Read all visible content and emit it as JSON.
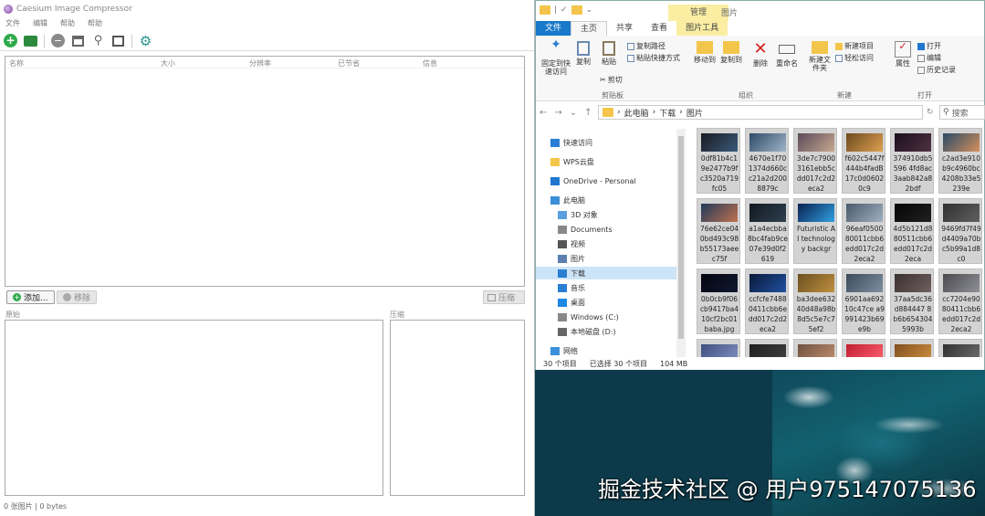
{
  "caesium": {
    "title": "Caesium Image Compressor",
    "menu": [
      "文件",
      "编辑",
      "帮助",
      "帮助"
    ],
    "columns": [
      "名称",
      "大小",
      "分辨率",
      "已节省",
      "信息"
    ],
    "add_button": "添加...",
    "remove_button": "移除",
    "compress_button": "压缩",
    "preview_original": "原始",
    "preview_compressed": "压缩",
    "status": "0 张图片 | 0 bytes"
  },
  "explorer": {
    "context_tab": "管理",
    "context_title": "图片",
    "tabs": [
      "文件",
      "主页",
      "共享",
      "查看",
      "图片工具"
    ],
    "ribbon": {
      "pin": "固定到快速访问",
      "copy": "复制",
      "paste": "粘贴",
      "copy_path": "复制路径",
      "paste_shortcut": "粘贴快捷方式",
      "cut": "剪切",
      "move_to": "移动到",
      "copy_to": "复制到",
      "delete": "删除",
      "rename": "重命名",
      "new_folder": "新建文件夹",
      "new_item": "新建项目",
      "easy_access": "轻松访问",
      "properties": "属性",
      "open": "打开",
      "edit": "编辑",
      "history": "历史记录",
      "group_clipboard": "剪贴板",
      "group_organize": "组织",
      "group_new": "新建",
      "group_open": "打开"
    },
    "breadcrumb": [
      "此电脑",
      "下载",
      "图片"
    ],
    "search_placeholder": "搜索",
    "nav": [
      {
        "label": "快速访问",
        "icon": "star-icon",
        "color": "#2a7fd4"
      },
      {
        "label": "WPS云盘",
        "icon": "cloud-folder-icon",
        "color": "#f3c54b"
      },
      {
        "label": "OneDrive - Personal",
        "icon": "onedrive-icon",
        "color": "#1f77d0"
      },
      {
        "label": "此电脑",
        "icon": "computer-icon",
        "color": "#3a8fd8"
      },
      {
        "label": "3D 对象",
        "icon": "cube-icon",
        "color": "#5aa0e0"
      },
      {
        "label": "Documents",
        "icon": "document-icon",
        "color": "#888888"
      },
      {
        "label": "视频",
        "icon": "video-icon",
        "color": "#555555"
      },
      {
        "label": "图片",
        "icon": "pictures-icon",
        "color": "#5a7fb0"
      },
      {
        "label": "下载",
        "icon": "download-icon",
        "color": "#2a7fd4"
      },
      {
        "label": "音乐",
        "icon": "music-icon",
        "color": "#2a7fd4"
      },
      {
        "label": "桌面",
        "icon": "desktop-icon",
        "color": "#1e88e5"
      },
      {
        "label": "Windows (C:)",
        "icon": "drive-icon",
        "color": "#888888"
      },
      {
        "label": "本地磁盘 (D:)",
        "icon": "drive-icon",
        "color": "#666666"
      },
      {
        "label": "网络",
        "icon": "network-icon",
        "color": "#3a8fd8"
      }
    ],
    "files": [
      {
        "name": "0df81b4c19e2477b9fc3520a719fc05",
        "colors": [
          "#1a1a22",
          "#3a5a7a"
        ]
      },
      {
        "name": "4670e1f701374d660cc21a2d2008879c",
        "colors": [
          "#2d4a66",
          "#9fb4c8"
        ]
      },
      {
        "name": "3de7c79003161ebb5cdd017c2d2eca2",
        "colors": [
          "#5a4a5a",
          "#c8a890"
        ]
      },
      {
        "name": "f602c5447f444b4fadB17c0d06020c9",
        "colors": [
          "#6a4a20",
          "#e0a050"
        ]
      },
      {
        "name": "374910db5596 4fd8ac3aab842a82bdf",
        "colors": [
          "#1a1020",
          "#503040"
        ]
      },
      {
        "name": "c2ad3e910b9c4960bc4208b33e5239e",
        "colors": [
          "#2a4a6a",
          "#d4905a"
        ]
      },
      {
        "name": "76e62ce040bd493c98b55173aeec75f",
        "colors": [
          "#203a5a",
          "#c07050"
        ]
      },
      {
        "name": "a1a4ecbba8bc4fab9ce07e39d0f2619",
        "colors": [
          "#101820",
          "#304050"
        ]
      },
      {
        "name": "Futuristic AI technology backgr",
        "colors": [
          "#0a2050",
          "#30a0e0"
        ]
      },
      {
        "name": "96eaf050080011cbb6edd017c2d2eca2",
        "colors": [
          "#4a5a6a",
          "#a0b0c0"
        ]
      },
      {
        "name": "4d5b121d880511cbb6edd017c2d2eca",
        "colors": [
          "#050505",
          "#202020"
        ]
      },
      {
        "name": "9469fd7f49d4409a70bc5b99a1d8c0",
        "colors": [
          "#303030",
          "#606060"
        ]
      },
      {
        "name": "0b0cb9f06cb9417ba410cf2bc01baba.jpg",
        "colors": [
          "#050510",
          "#101830"
        ]
      },
      {
        "name": "ccfcfe74880411cbb6edd017c2d2eca2",
        "colors": [
          "#0a1a3a",
          "#2050a0"
        ]
      },
      {
        "name": "ba3dee63240d48a98b8d5c5e7c75ef2",
        "colors": [
          "#6a5020",
          "#c09040"
        ]
      },
      {
        "name": "6901aa69210c47ce a9991423b69e9b",
        "colors": [
          "#3a4a5a",
          "#8090a0"
        ]
      },
      {
        "name": "37aa5dc36d884447 8b6b6543045993b",
        "colors": [
          "#3a3030",
          "#706060"
        ]
      },
      {
        "name": "cc7204e9080411cbb6edd017c2d2eca2",
        "colors": [
          "#4a4a50",
          "#909098"
        ]
      },
      {
        "name": "",
        "colors": [
          "#405080",
          "#8090c0"
        ]
      },
      {
        "name": "",
        "colors": [
          "#202020",
          "#404040"
        ]
      },
      {
        "name": "",
        "colors": [
          "#705040",
          "#c09070"
        ]
      },
      {
        "name": "",
        "colors": [
          "#c02030",
          "#ff6070"
        ]
      },
      {
        "name": "",
        "colors": [
          "#805020",
          "#d09040"
        ]
      },
      {
        "name": "",
        "colors": [
          "#303030",
          "#707070"
        ]
      }
    ],
    "status_count": "30 个项目",
    "status_selected": "已选择 30 个项目",
    "status_size": "104 MB"
  },
  "watermark": "掘金技术社区 @ 用户975147075136"
}
